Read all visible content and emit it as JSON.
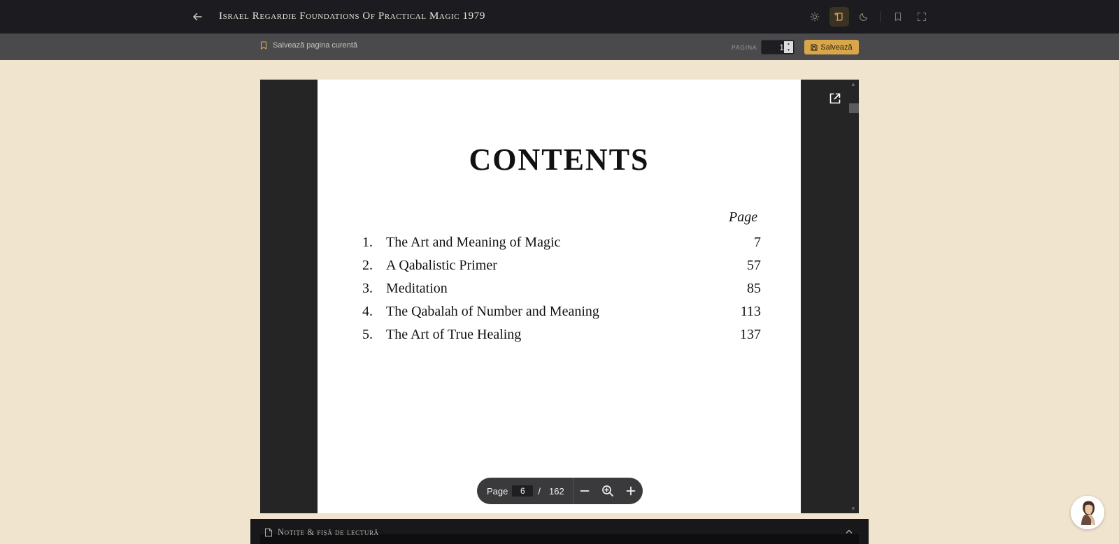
{
  "header": {
    "title": "Israel Regardie Foundations Of Practical Magic 1979",
    "icons": [
      "back-arrow-icon",
      "sun-icon",
      "scroll-icon",
      "moon-icon",
      "bookmark-icon",
      "fullscreen-icon"
    ],
    "accent_color": "#d9a74a"
  },
  "toolbar": {
    "save_current_label": "Salvează pagina curentă",
    "pagina_label": "PAGINA",
    "page_value": "1",
    "save_label": "Salvează"
  },
  "document": {
    "heading": "CONTENTS",
    "page_col_label": "Page",
    "toc": [
      {
        "num": "1.",
        "title": "The Art and Meaning of Magic",
        "page": "7"
      },
      {
        "num": "2.",
        "title": "A Qabalistic Primer",
        "page": "57"
      },
      {
        "num": "3.",
        "title": "Meditation",
        "page": "85"
      },
      {
        "num": "4.",
        "title": "The Qabalah of Number and Meaning",
        "page": "113"
      },
      {
        "num": "5.",
        "title": "The Art of True Healing",
        "page": "137"
      }
    ]
  },
  "pager": {
    "label": "Page",
    "current": "6",
    "separator": "/",
    "total": "162"
  },
  "notes": {
    "label": "Notițe & fișă de lectură"
  }
}
